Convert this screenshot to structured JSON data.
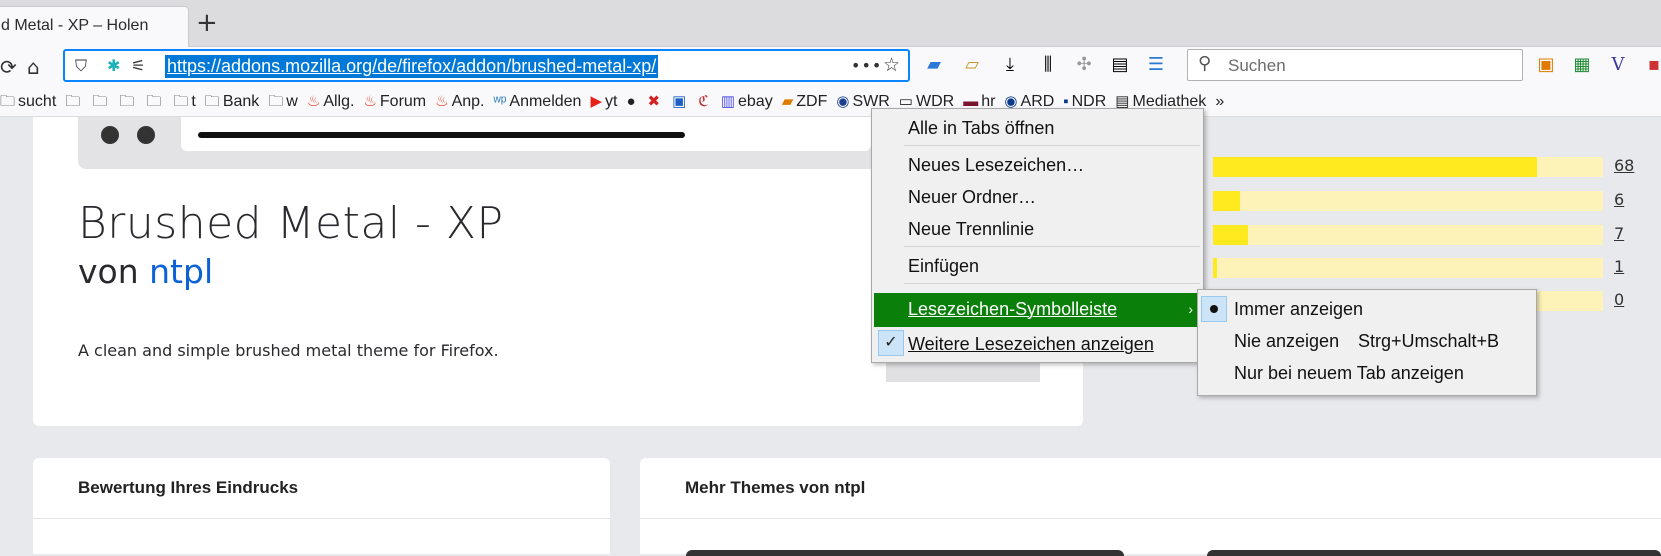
{
  "tab": {
    "title": "d Metal - XP – Holen"
  },
  "navbar": {
    "url": "https://addons.mozilla.org/de/firefox/addon/brushed-metal-xp/",
    "search_placeholder": "Suchen"
  },
  "bookmarks": [
    {
      "icon": "folder-icon",
      "label": "sucht"
    },
    {
      "icon": "folder-icon",
      "label": ""
    },
    {
      "icon": "folder-icon",
      "label": ""
    },
    {
      "icon": "folder-icon",
      "label": ""
    },
    {
      "icon": "folder-icon",
      "label": ""
    },
    {
      "icon": "folder-icon",
      "label": "t"
    },
    {
      "icon": "folder-icon",
      "label": "Bank"
    },
    {
      "icon": "folder-icon",
      "label": "w"
    },
    {
      "icon": "flame-icon",
      "label": "Allg."
    },
    {
      "icon": "flame-icon",
      "label": "Forum"
    },
    {
      "icon": "flame-icon",
      "label": "Anp."
    },
    {
      "icon": "wp-icon",
      "label": "Anmelden"
    },
    {
      "icon": "youtube-icon",
      "label": "yt"
    },
    {
      "icon": "github-icon",
      "label": ""
    },
    {
      "icon": "x-icon",
      "label": ""
    },
    {
      "icon": "cb-icon",
      "label": ""
    },
    {
      "icon": "cy-icon",
      "label": ""
    },
    {
      "icon": "ebay-icon",
      "label": "ebay"
    },
    {
      "icon": "zdf-icon",
      "label": "ZDF"
    },
    {
      "icon": "swr-icon",
      "label": "SWR"
    },
    {
      "icon": "wdr-icon",
      "label": "WDR"
    },
    {
      "icon": "hr-icon",
      "label": "hr"
    },
    {
      "icon": "ard-icon",
      "label": "ARD"
    },
    {
      "icon": "ndr-icon",
      "label": "NDR"
    },
    {
      "icon": "clapper-icon",
      "label": "Mediathek"
    }
  ],
  "addon": {
    "title": "Brushed Metal - XP",
    "by_prefix": "von",
    "author": "ntpl",
    "description": "A clean and simple brushed metal theme for Firefox."
  },
  "ratings": [
    {
      "count": "68",
      "fraction": 0.83
    },
    {
      "count": "6",
      "fraction": 0.07
    },
    {
      "count": "7",
      "fraction": 0.09
    },
    {
      "count": "1",
      "fraction": 0.01
    },
    {
      "count": "0",
      "fraction": 0.0
    }
  ],
  "cards": {
    "rating_title": "Bewertung Ihres Eindrucks",
    "more_title": "Mehr Themes von ntpl"
  },
  "context_menu": {
    "open_all": "Alle in Tabs öffnen",
    "new_bookmark": "Neues Lesezeichen…",
    "new_folder": "Neuer Ordner…",
    "new_separator": "Neue Trennlinie",
    "paste": "Einfügen",
    "bookmarks_toolbar": "Lesezeichen-Symbolleiste",
    "show_other": "Weitere Lesezeichen anzeigen"
  },
  "submenu": {
    "always": "Immer anzeigen",
    "never": "Nie anzeigen",
    "never_shortcut": "Strg+Umschalt+B",
    "new_tab_only": "Nur bei neuem Tab anzeigen"
  }
}
